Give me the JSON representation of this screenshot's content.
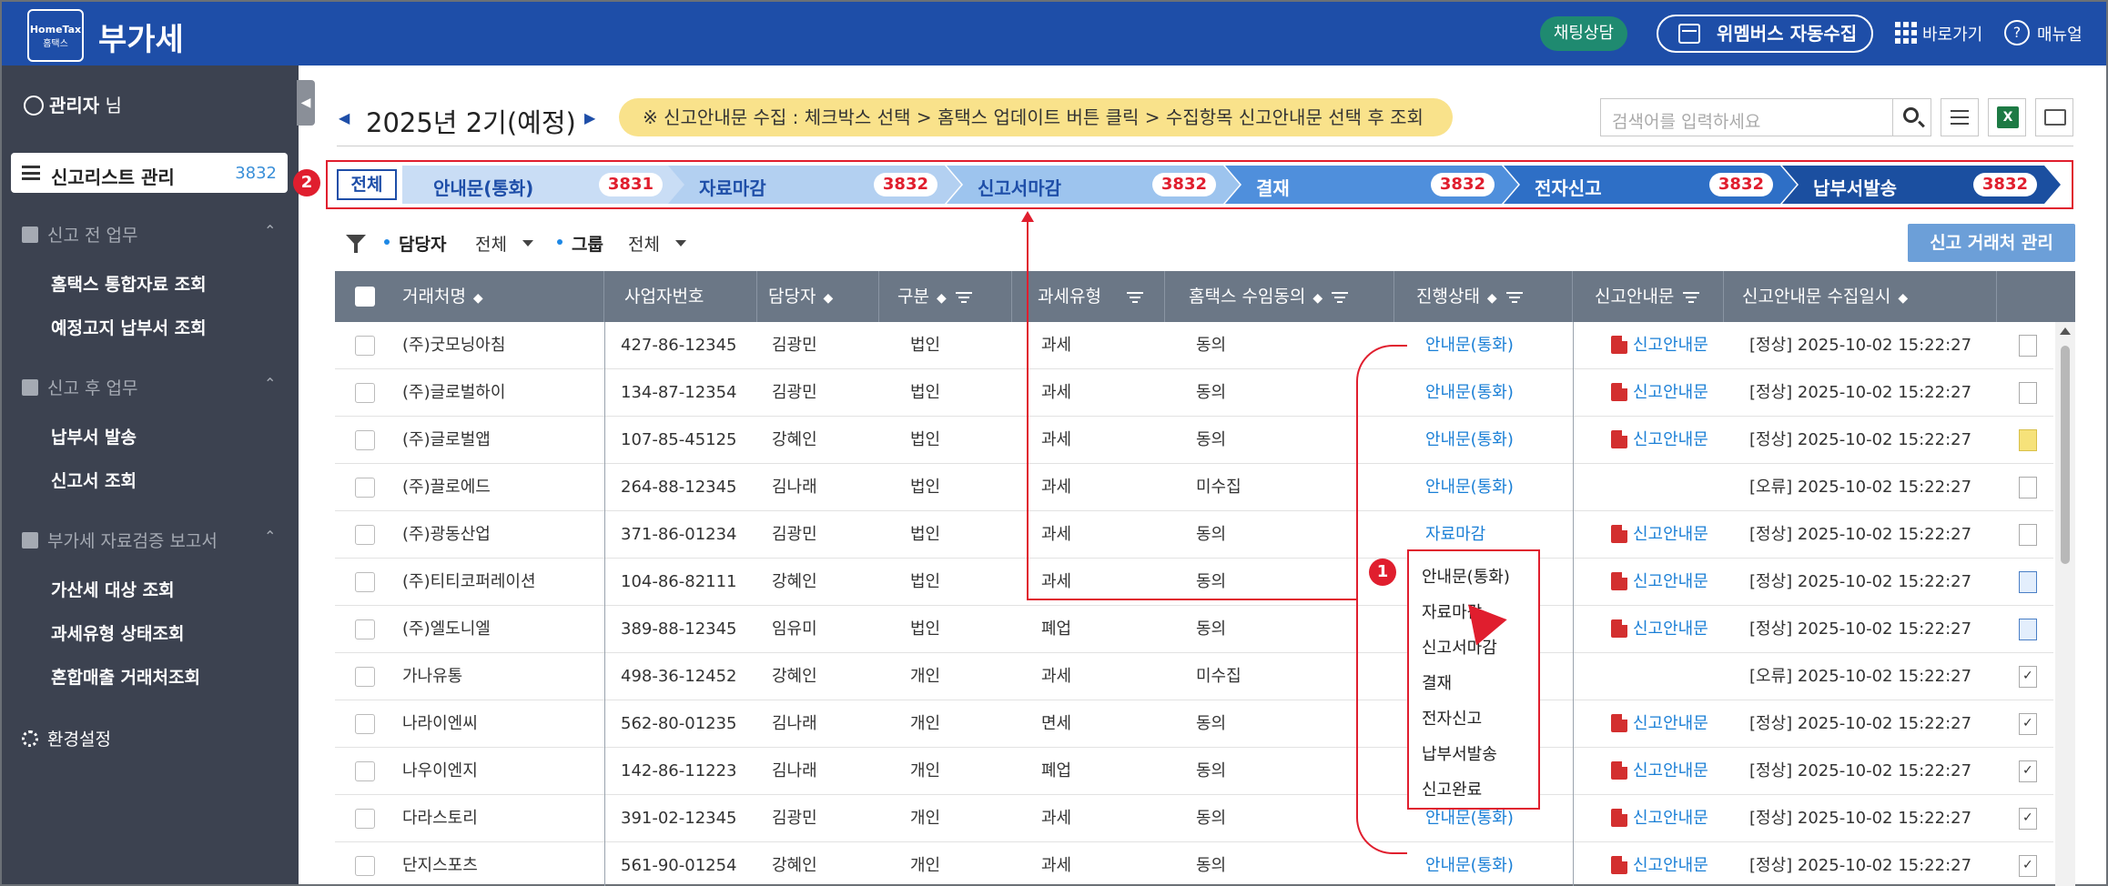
{
  "app": {
    "logo_text": "HomeTax",
    "logo_sub": "홈택스",
    "title": "부가세"
  },
  "topbar": {
    "chat": "채팅상담",
    "wemb": "위멤버스 자동수집",
    "shortcut": "바로가기",
    "help_glyph": "?",
    "manual": "매뉴얼"
  },
  "sidebar": {
    "admin_name": "관리자",
    "admin_suffix": " 님",
    "active": {
      "label": "신고리스트 관리",
      "count": "3832"
    },
    "sections": [
      {
        "title": "신고 전 업무",
        "items": [
          "홈택스 통합자료 조회",
          "예정고지 납부서 조회"
        ]
      },
      {
        "title": "신고 후 업무",
        "items": [
          "납부서 발송",
          "신고서 조회"
        ]
      },
      {
        "title": "부가세 자료검증 보고서",
        "items": [
          "가산세 대상 조회",
          "과세유형 상태조회",
          "혼합매출 거래처조회"
        ]
      }
    ],
    "settings": "환경설정"
  },
  "header": {
    "period": "2025년 2기(예정)",
    "notice": "※ 신고안내문 수집 : 체크박스 선택 > 홈택스 업데이트 버튼 클릭 > 수집항목 신고안내문 선택 후 조회",
    "search_placeholder": "검색어를 입력하세요",
    "excel_glyph": "X"
  },
  "pipeline": {
    "all": "전체",
    "stages": [
      {
        "label": "안내문(통화)",
        "count": "3831",
        "bg": "#c9ddf5",
        "fg": "#1e4ea8"
      },
      {
        "label": "자료마감",
        "count": "3832",
        "bg": "#b3d0f1",
        "fg": "#1e4ea8"
      },
      {
        "label": "신고서마감",
        "count": "3832",
        "bg": "#9dc4ee",
        "fg": "#1e4ea8"
      },
      {
        "label": "결재",
        "count": "3832",
        "bg": "#4f8fdc",
        "fg": "#ffffff"
      },
      {
        "label": "전자신고",
        "count": "3832",
        "bg": "#2e6fc6",
        "fg": "#ffffff"
      },
      {
        "label": "납부서발송",
        "count": "3832",
        "bg": "#1b4fa0",
        "fg": "#ffffff"
      }
    ]
  },
  "filters": {
    "manager_label": "담당자",
    "manager_value": "전체",
    "group_label": "그룹",
    "group_value": "전체",
    "manage_button": "신고 거래처 관리"
  },
  "table": {
    "columns": [
      "거래처명",
      "사업자번호",
      "담당자",
      "구분",
      "과세유형",
      "홈택스 수임동의",
      "진행상태",
      "신고안내문",
      "신고안내문 수집일시"
    ],
    "rows": [
      {
        "name": "(주)굿모닝아침",
        "biz": "427-86-12345",
        "mgr": "김광민",
        "type": "법인",
        "tax": "과세",
        "consent": "동의",
        "status": "안내문(통화)",
        "doc": "신고안내문",
        "collected": "[정상] 2025-10-02 15:22:27",
        "icon": "plain"
      },
      {
        "name": "(주)글로벌하이",
        "biz": "134-87-12354",
        "mgr": "김광민",
        "type": "법인",
        "tax": "과세",
        "consent": "동의",
        "status": "안내문(통화)",
        "doc": "신고안내문",
        "collected": "[정상] 2025-10-02 15:22:27",
        "icon": "plain"
      },
      {
        "name": "(주)글로벌앱",
        "biz": "107-85-45125",
        "mgr": "강혜인",
        "type": "법인",
        "tax": "과세",
        "consent": "동의",
        "status": "안내문(통화)",
        "doc": "신고안내문",
        "collected": "[정상] 2025-10-02 15:22:27",
        "icon": "yellow"
      },
      {
        "name": "(주)끌로에드",
        "biz": "264-88-12345",
        "mgr": "김나래",
        "type": "법인",
        "tax": "과세",
        "consent": "미수집",
        "status": "안내문(통화)",
        "doc": "",
        "collected": "[오류] 2025-10-02 15:22:27",
        "icon": "plain"
      },
      {
        "name": "(주)광동산업",
        "biz": "371-86-01234",
        "mgr": "김광민",
        "type": "법인",
        "tax": "과세",
        "consent": "동의",
        "status": "자료마감",
        "doc": "신고안내문",
        "collected": "[정상] 2025-10-02 15:22:27",
        "icon": "plain"
      },
      {
        "name": "(주)티티코퍼레이션",
        "biz": "104-86-82111",
        "mgr": "강혜인",
        "type": "법인",
        "tax": "과세",
        "consent": "동의",
        "status": "",
        "doc": "신고안내문",
        "collected": "[정상] 2025-10-02 15:22:27",
        "icon": "blue"
      },
      {
        "name": "(주)엘도니엘",
        "biz": "389-88-12345",
        "mgr": "임유미",
        "type": "법인",
        "tax": "폐업",
        "consent": "동의",
        "status": "",
        "doc": "신고안내문",
        "collected": "[정상] 2025-10-02 15:22:27",
        "icon": "blue"
      },
      {
        "name": "가나유통",
        "biz": "498-36-12452",
        "mgr": "강혜인",
        "type": "개인",
        "tax": "과세",
        "consent": "미수집",
        "status": "",
        "doc": "",
        "collected": "[오류] 2025-10-02 15:22:27",
        "icon": "check"
      },
      {
        "name": "나라이엔씨",
        "biz": "562-80-01235",
        "mgr": "김나래",
        "type": "개인",
        "tax": "면세",
        "consent": "동의",
        "status": "",
        "doc": "신고안내문",
        "collected": "[정상] 2025-10-02 15:22:27",
        "icon": "check"
      },
      {
        "name": "나우이엔지",
        "biz": "142-86-11223",
        "mgr": "김나래",
        "type": "개인",
        "tax": "폐업",
        "consent": "동의",
        "status": "",
        "doc": "신고안내문",
        "collected": "[정상] 2025-10-02 15:22:27",
        "icon": "check"
      },
      {
        "name": "다라스토리",
        "biz": "391-02-12345",
        "mgr": "김광민",
        "type": "개인",
        "tax": "과세",
        "consent": "동의",
        "status": "안내문(통화)",
        "doc": "신고안내문",
        "collected": "[정상] 2025-10-02 15:22:27",
        "icon": "check"
      },
      {
        "name": "단지스포츠",
        "biz": "561-90-01254",
        "mgr": "강혜인",
        "type": "개인",
        "tax": "과세",
        "consent": "동의",
        "status": "안내문(통화)",
        "doc": "신고안내문",
        "collected": "[정상] 2025-10-02 15:22:27",
        "icon": "check"
      }
    ]
  },
  "annotation": {
    "badge1": "1",
    "badge2": "2",
    "dropdown": [
      "안내문(통화)",
      "자료마감",
      "신고서마감",
      "결재",
      "전자신고",
      "납부서발송",
      "신고완료"
    ]
  }
}
